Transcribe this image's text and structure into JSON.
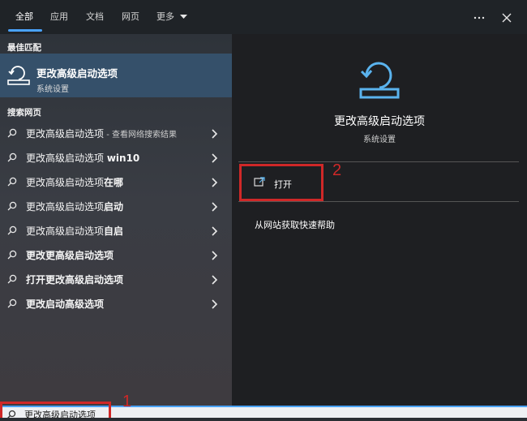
{
  "tabs": [
    {
      "label": "全部"
    },
    {
      "label": "应用"
    },
    {
      "label": "文档"
    },
    {
      "label": "网页"
    },
    {
      "label": "更多"
    }
  ],
  "left": {
    "best_match_heading": "最佳匹配",
    "best_match": {
      "title": "更改高级启动选项",
      "subtitle": "系统设置"
    },
    "web_heading": "搜索网页",
    "web_results": [
      {
        "pre": "更改高级启动选项",
        "bold": "",
        "suffix": " - 查看网络搜索结果"
      },
      {
        "pre": "更改高级启动选项 ",
        "bold": "win10",
        "suffix": ""
      },
      {
        "pre": "更改高级启动选项",
        "bold": "在哪",
        "suffix": ""
      },
      {
        "pre": "更改高级启动选项",
        "bold": "启动",
        "suffix": ""
      },
      {
        "pre": "更改高级启动选项",
        "bold": "自启",
        "suffix": ""
      },
      {
        "pre": "",
        "bold": "更改更高级启动选项",
        "suffix": ""
      },
      {
        "pre": "",
        "bold": "打开更改高级启动选项",
        "suffix": ""
      },
      {
        "pre": "",
        "bold": "更改启动高级选项",
        "suffix": ""
      }
    ]
  },
  "right": {
    "app_title": "更改高级启动选项",
    "app_subtitle": "系统设置",
    "open_label": "打开",
    "web_help": "从网站获取快速帮助"
  },
  "search": {
    "value": "更改高级启动选项"
  },
  "annotations": {
    "one": "1",
    "two": "2"
  },
  "colors": {
    "accent": "#4aa3ff",
    "highlight": "#d02828",
    "selected_row": "#35506a"
  },
  "icons": [
    "search-icon",
    "chevron-right-icon",
    "more-icon",
    "close-icon",
    "recovery-icon",
    "open-icon",
    "caret-down-icon"
  ]
}
